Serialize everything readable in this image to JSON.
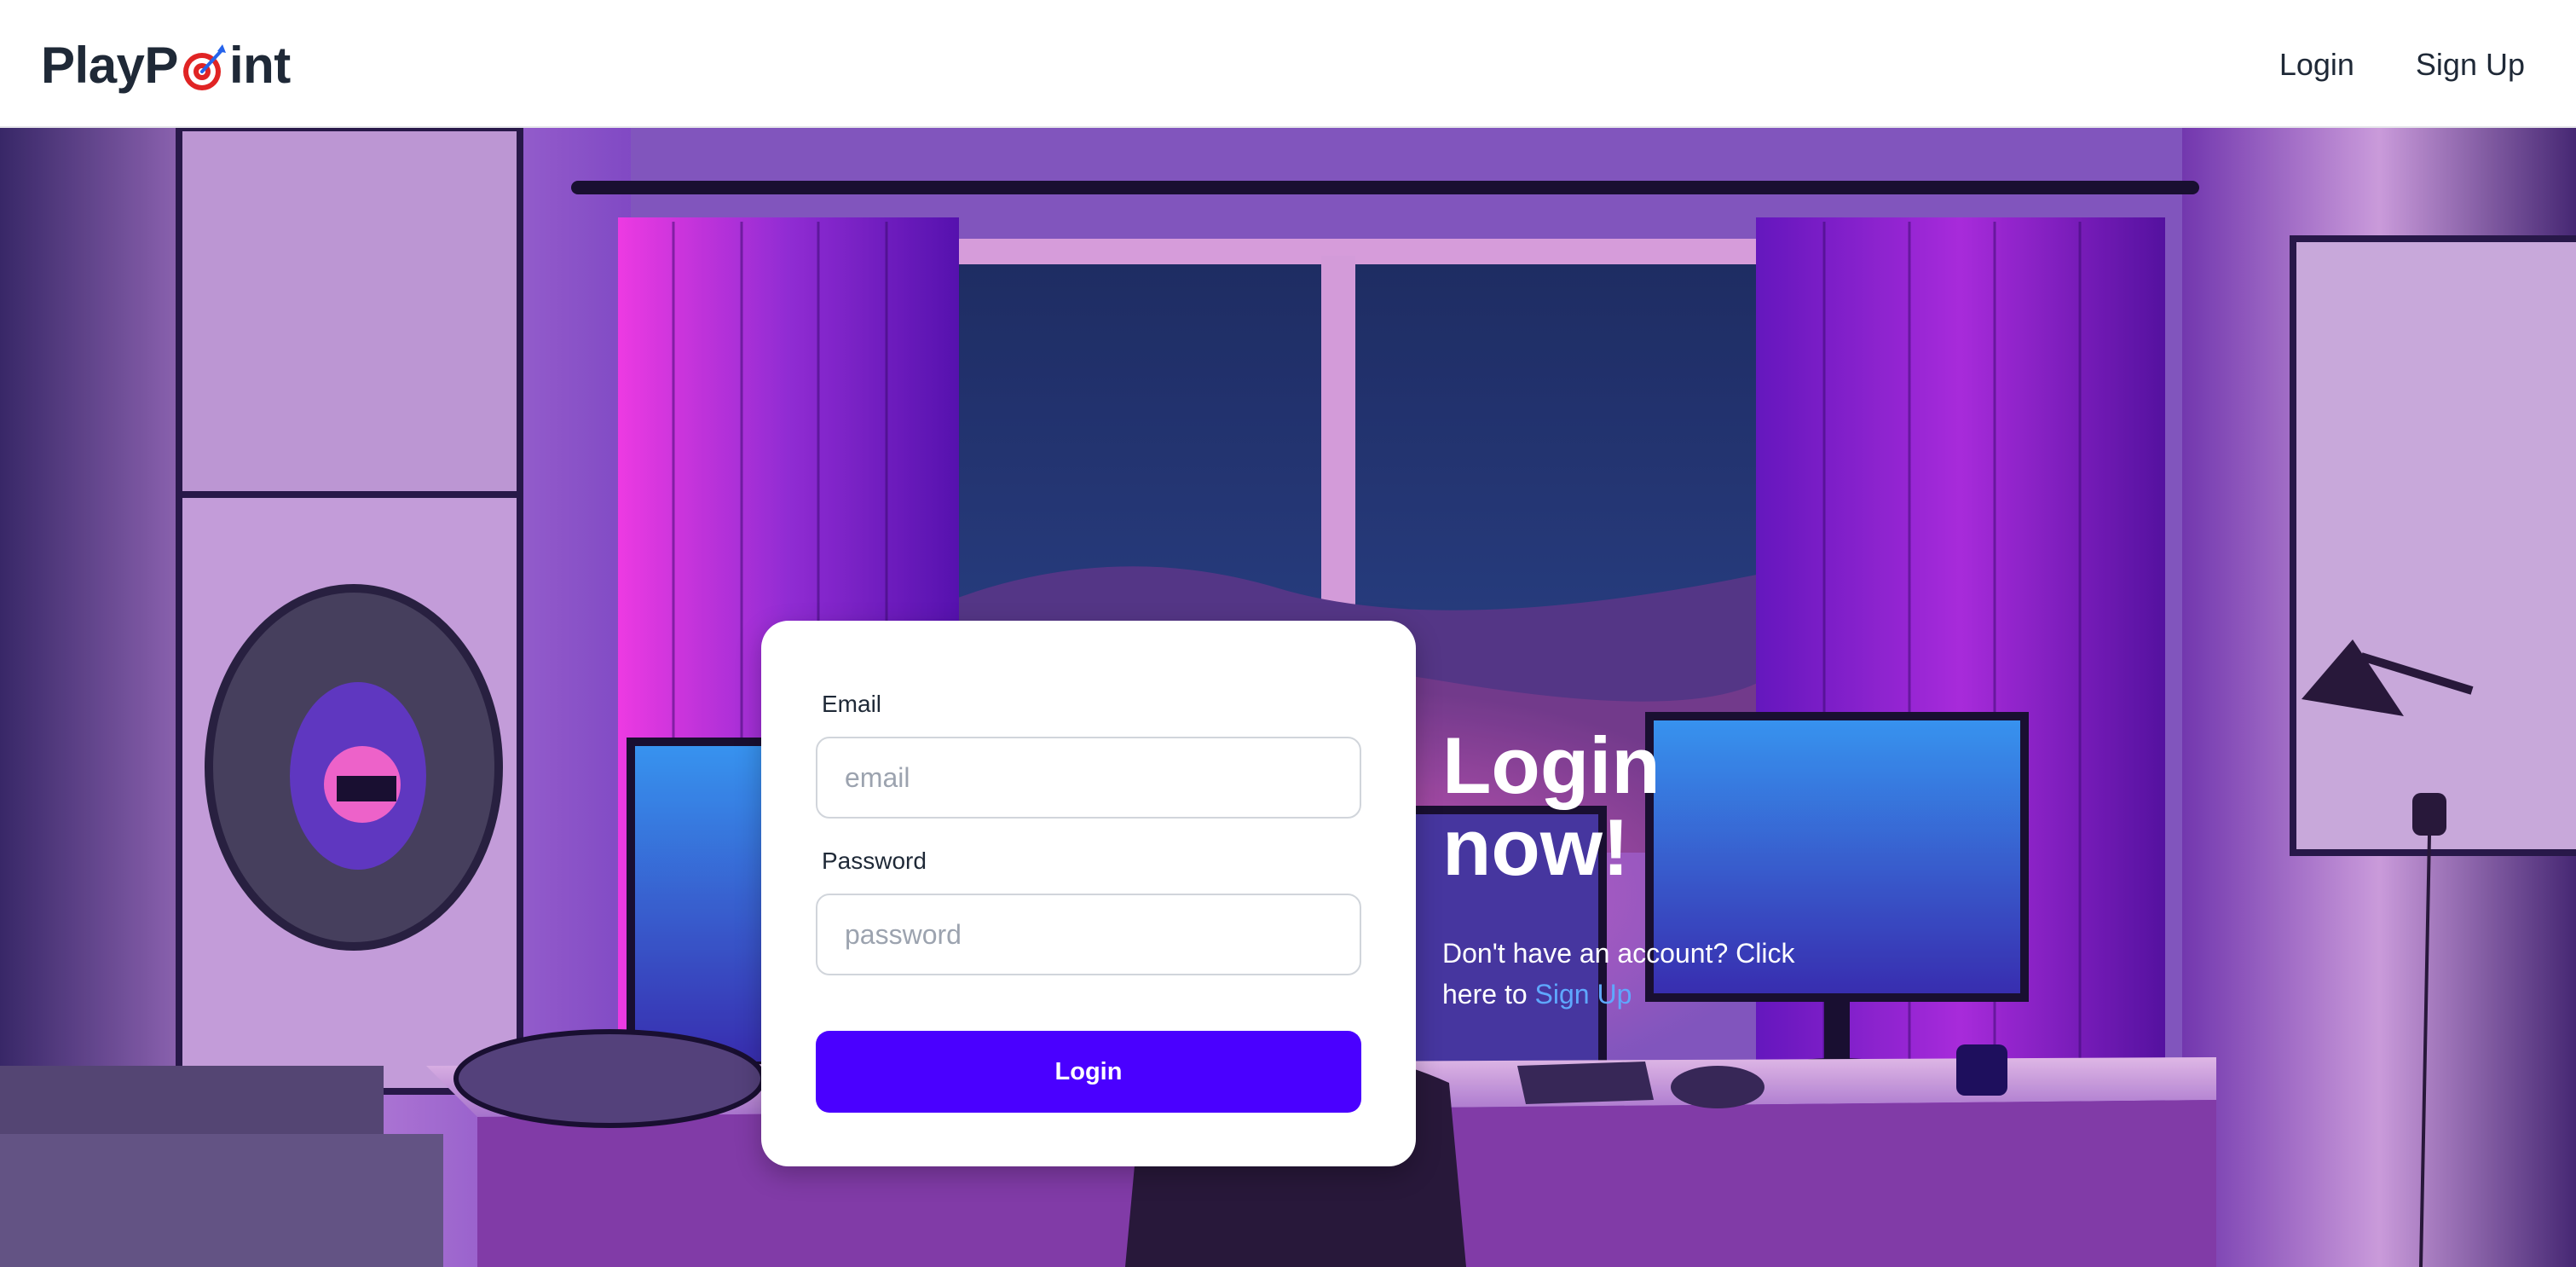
{
  "brand": {
    "name_prefix": "PlayP",
    "name_suffix": "int",
    "logo_icon": "target-dart-icon"
  },
  "nav": {
    "login": "Login",
    "signup": "Sign Up"
  },
  "form": {
    "email_label": "Email",
    "email_placeholder": "email",
    "email_value": "",
    "password_label": "Password",
    "password_placeholder": "password",
    "password_value": "",
    "submit_label": "Login"
  },
  "hero": {
    "headline_line1": "Login",
    "headline_line2": "now!",
    "prompt_text": "Don't have an account? Click here to",
    "prompt_link": "Sign Up",
    "background": "gaming-room-illustration"
  },
  "colors": {
    "accent": "#4a00ff",
    "link": "#5fa8ff",
    "text_dark": "#1f2937",
    "logo_target_red": "#e02424",
    "logo_dart_blue": "#2563eb"
  }
}
